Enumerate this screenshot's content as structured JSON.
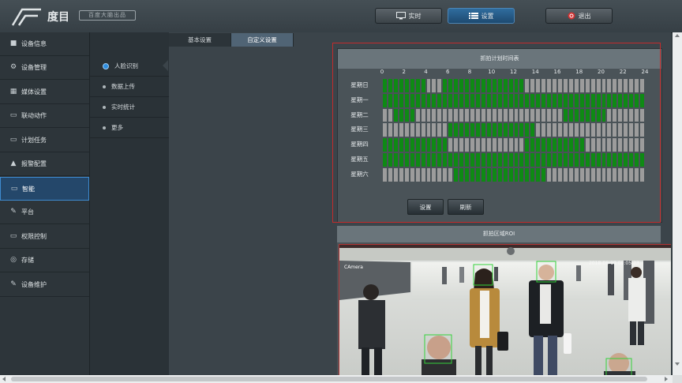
{
  "header": {
    "brand": "度目",
    "tagline": "百度大脑出品",
    "buttons": [
      {
        "label": "实时",
        "icon": "monitor-icon",
        "active": false
      },
      {
        "label": "设置",
        "icon": "list-icon",
        "active": true
      },
      {
        "label": "退出",
        "icon": "power-icon",
        "active": false
      }
    ]
  },
  "sidebar": {
    "items": [
      {
        "label": "设备信息",
        "icon": "camera-icon"
      },
      {
        "label": "设备管理",
        "icon": "gear-icon"
      },
      {
        "label": "媒体设置",
        "icon": "media-icon"
      },
      {
        "label": "联动动作",
        "icon": "linkage-icon"
      },
      {
        "label": "计划任务",
        "icon": "schedule-icon"
      },
      {
        "label": "报警配置",
        "icon": "alarm-icon"
      },
      {
        "label": "智能",
        "icon": "monitor-icon",
        "active": true
      },
      {
        "label": "平台",
        "icon": "wrench-icon"
      },
      {
        "label": "权限控制",
        "icon": "monitor-icon"
      },
      {
        "label": "存储",
        "icon": "storage-icon"
      },
      {
        "label": "设备维护",
        "icon": "tools-icon"
      }
    ]
  },
  "subnav": {
    "items": [
      {
        "label": "人脸识别",
        "active": true
      },
      {
        "label": "数据上传"
      },
      {
        "label": "实时统计"
      },
      {
        "label": "更多"
      }
    ]
  },
  "tabs": [
    {
      "label": "基本设置",
      "active": false
    },
    {
      "label": "自定义设置",
      "active": true
    }
  ],
  "schedule": {
    "title": "抓拍计划时间表",
    "hour_ticks": [
      "0",
      "2",
      "4",
      "6",
      "8",
      "10",
      "12",
      "14",
      "16",
      "18",
      "20",
      "22",
      "24"
    ],
    "days": [
      {
        "label": "星期日",
        "ranges": [
          [
            0,
            4
          ],
          [
            5.5,
            13
          ]
        ]
      },
      {
        "label": "星期一",
        "ranges": [
          [
            0,
            24
          ]
        ]
      },
      {
        "label": "星期二",
        "ranges": [
          [
            1,
            3
          ],
          [
            16.5,
            20.5
          ]
        ]
      },
      {
        "label": "星期三",
        "ranges": [
          [
            6,
            14
          ]
        ]
      },
      {
        "label": "星期四",
        "ranges": [
          [
            0,
            6
          ],
          [
            13,
            18.5
          ]
        ]
      },
      {
        "label": "星期五",
        "ranges": [
          [
            0,
            24
          ]
        ]
      },
      {
        "label": "星期六",
        "ranges": [
          [
            6.5,
            15
          ]
        ]
      }
    ],
    "colors": {
      "on": "#0e8a14",
      "off": "#9c9c9c"
    },
    "buttons": [
      {
        "label": "设置"
      },
      {
        "label": "刷新"
      }
    ]
  },
  "roi": {
    "title": "抓拍区域ROI",
    "overlay_text": "2018-06-19 09:05:23",
    "camera_label": "CAmera"
  }
}
